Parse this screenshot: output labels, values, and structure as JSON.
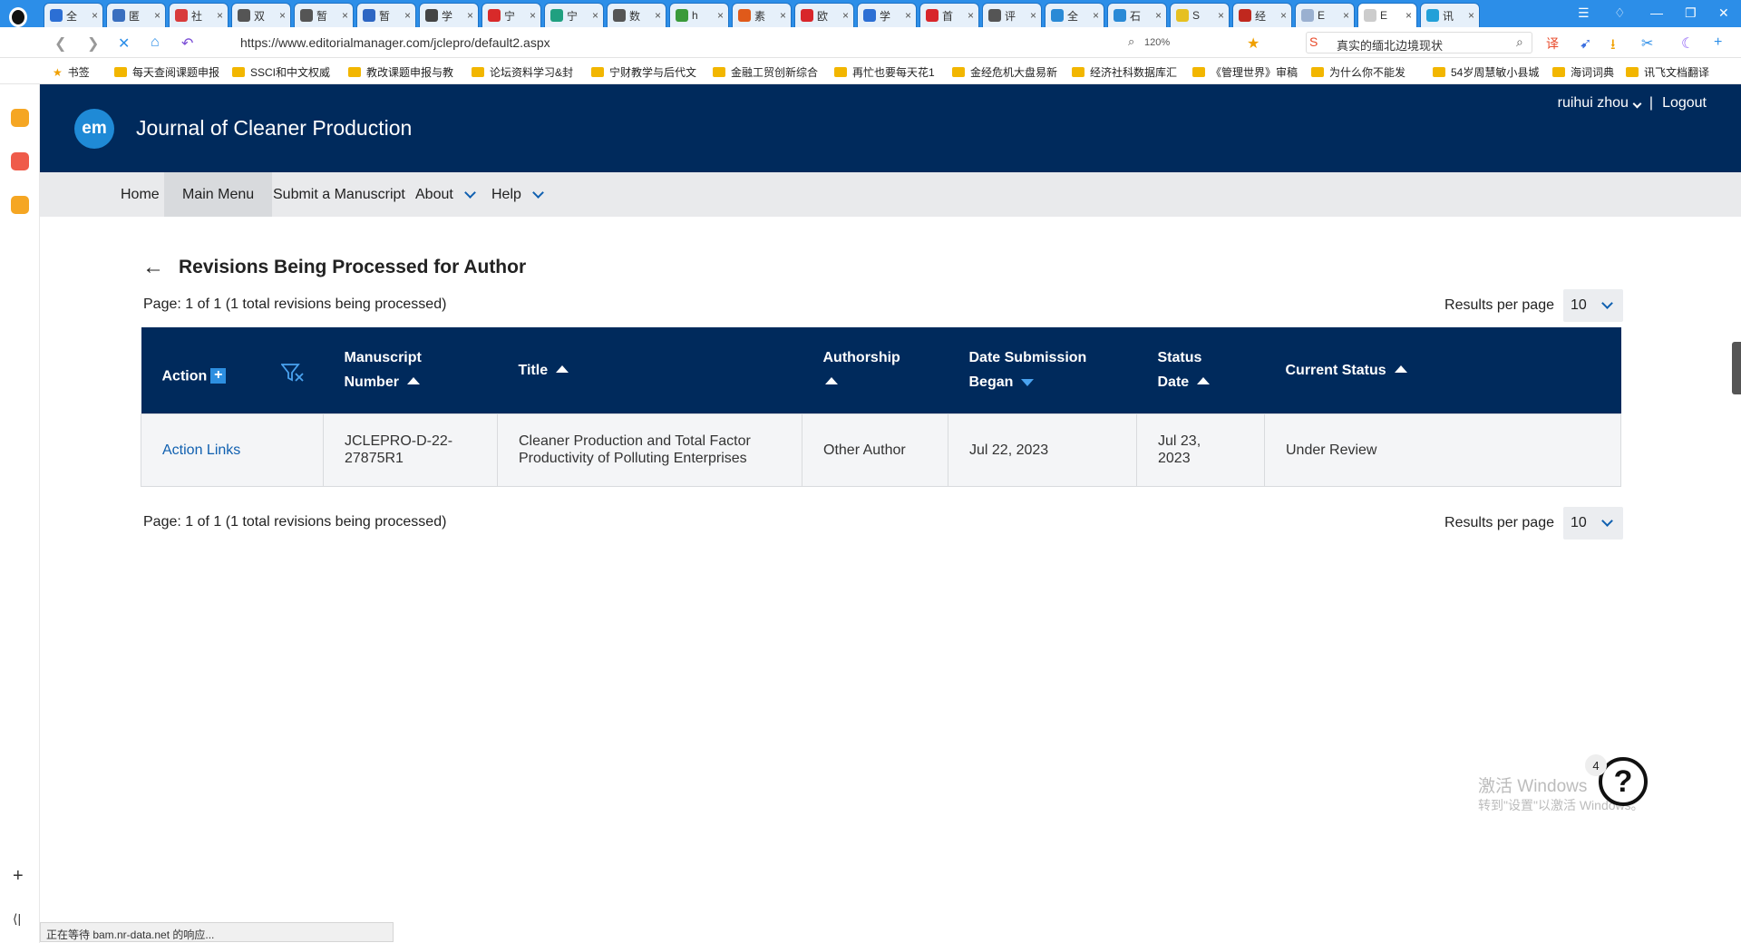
{
  "browser": {
    "tabs": [
      {
        "label": "全",
        "color": "#2c6fd4"
      },
      {
        "label": "匿",
        "color": "#3a6fbf"
      },
      {
        "label": "社",
        "color": "#d83b3b"
      },
      {
        "label": "双",
        "color": "#555555"
      },
      {
        "label": "暂",
        "color": "#555555"
      },
      {
        "label": "暂",
        "color": "#2d66c3"
      },
      {
        "label": "学",
        "color": "#444444"
      },
      {
        "label": "宁",
        "color": "#d82a2a"
      },
      {
        "label": "宁",
        "color": "#20a080"
      },
      {
        "label": "数",
        "color": "#555555"
      },
      {
        "label": "h",
        "color": "#3a9a3a"
      },
      {
        "label": "素",
        "color": "#e05a1a"
      },
      {
        "label": "欧",
        "color": "#d8262b"
      },
      {
        "label": "学",
        "color": "#2c6fd4"
      },
      {
        "label": "首",
        "color": "#d8262b"
      },
      {
        "label": "评",
        "color": "#555555"
      },
      {
        "label": "全",
        "color": "#2a8ad6"
      },
      {
        "label": "石",
        "color": "#2a8ad6"
      },
      {
        "label": "S",
        "color": "#e6c020"
      },
      {
        "label": "经",
        "color": "#c0281e"
      },
      {
        "label": "E",
        "color": "#9ab0d0"
      },
      {
        "label": "E",
        "color": "#cccccc"
      },
      {
        "label": "讯",
        "color": "#22a0d8"
      }
    ],
    "url": "https://www.editorialmanager.com/jclepro/default2.aspx",
    "zoom": "120%",
    "search_text": "真实的缅北边境现状",
    "bookmarks_label": "书签",
    "bookmarks": [
      "每天查阅课题申报",
      "SSCI和中文权威",
      "教改课题申报与教",
      "论坛资料学习&封",
      "宁财教学与后代文",
      "金融工贸创新综合",
      "再忙也要每天花1",
      "金经危机大盘易新",
      "经济社科数据库汇",
      "《管理世界》审稿",
      "为什么你不能发",
      "54岁周慧敏小县城",
      "海词词典",
      "讯飞文档翻译"
    ],
    "status_text": "正在等待 bam.nr-data.net 的响应..."
  },
  "header": {
    "logo_text": "em",
    "journal_title": "Journal of Cleaner Production",
    "user_name": "ruihui zhou",
    "separator": "|",
    "logout_label": "Logout"
  },
  "nav": {
    "home": "Home",
    "main_menu": "Main Menu",
    "submit": "Submit a Manuscript",
    "about": "About",
    "help": "Help"
  },
  "main": {
    "title": "Revisions Being Processed for Author",
    "page_info": "Page: 1 of 1 (1 total revisions being processed)",
    "results_per_page_label": "Results per page",
    "results_per_page_value": "10",
    "table": {
      "headers": {
        "action": "Action",
        "manuscript_number_1": "Manuscript",
        "manuscript_number_2": "Number",
        "title": "Title",
        "authorship": "Authorship",
        "date_submission_1": "Date Submission",
        "date_submission_2": "Began",
        "status_date_1": "Status",
        "status_date_2": "Date",
        "current_status": "Current Status"
      },
      "rows": [
        {
          "action": "Action Links",
          "manuscript_number_1": "JCLEPRO-D-22-",
          "manuscript_number_2": "27875R1",
          "title_1": "Cleaner Production and Total Factor",
          "title_2": "Productivity of Polluting Enterprises",
          "authorship": "Other Author",
          "date_submission_began": "Jul 22, 2023",
          "status_date_1": "Jul 23,",
          "status_date_2": "2023",
          "current_status": "Under Review"
        }
      ]
    }
  },
  "overlay": {
    "help_symbol": "?",
    "help_badge": "4",
    "watermark_line1": "激活 Windows",
    "watermark_line2": "转到\"设置\"以激活 Windows。"
  }
}
